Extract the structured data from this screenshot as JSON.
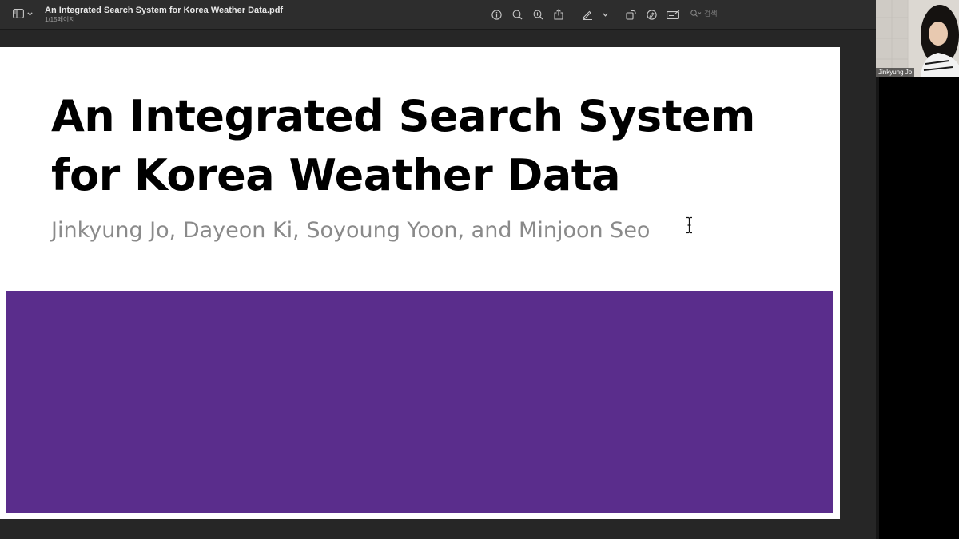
{
  "window": {
    "doc_title": "An Integrated Search System for Korea Weather Data.pdf",
    "page_info": "1/15페이지"
  },
  "toolbar": {
    "search_placeholder": "검색",
    "icons": [
      "info-icon",
      "zoom-out-icon",
      "zoom-in-icon",
      "share-icon",
      "markup-pen-icon",
      "chevron-down-icon",
      "rotate-icon",
      "markup-circle-icon",
      "form-fill-icon",
      "search-icon"
    ]
  },
  "slide": {
    "title": "An Integrated Search System for Korea Weather Data",
    "authors": "Jinkyung Jo, Dayeon Ki, Soyoung Yoon, and Minjoon Seo",
    "band_color": "#5a2d8c"
  },
  "participant": {
    "name": "Jinkyung Jo"
  },
  "colors": {
    "titlebar_bg": "#2d2d2d",
    "slide_bg": "#ffffff",
    "title_text": "#000000",
    "authors_text": "#8a8a8a",
    "band": "#5a2d8c"
  }
}
